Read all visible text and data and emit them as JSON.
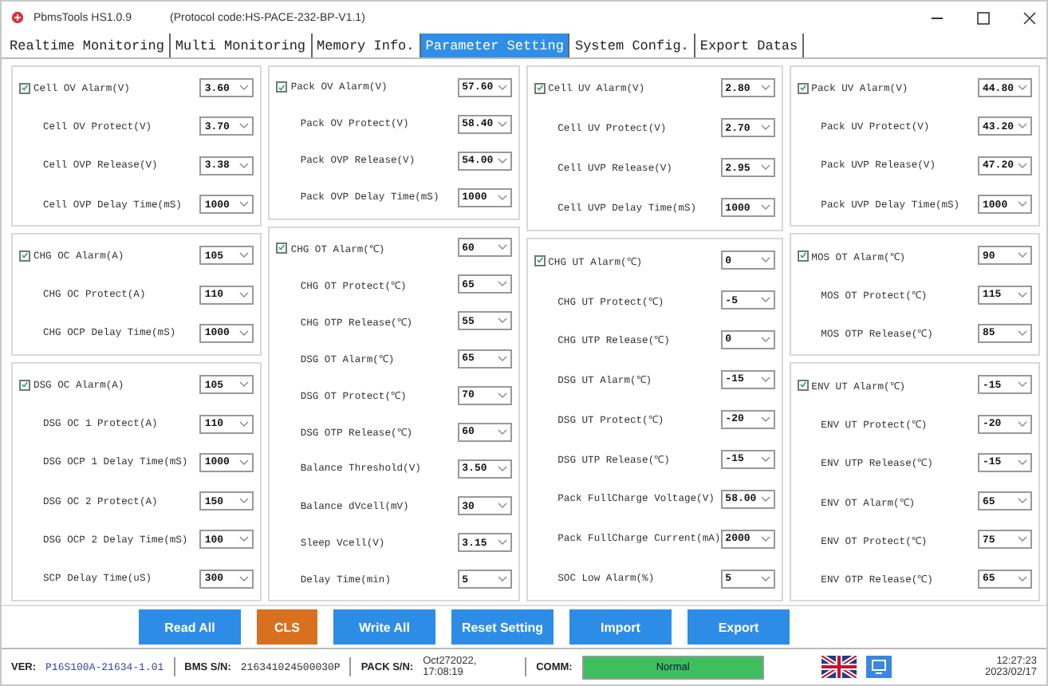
{
  "window": {
    "title": "PbmsTools HS1.0.9",
    "subtitle": "(Protocol code:HS-PACE-232-BP-V1.1)"
  },
  "tabs": [
    {
      "label": "Realtime Monitoring",
      "selected": false
    },
    {
      "label": "Multi Monitoring",
      "selected": false
    },
    {
      "label": "Memory Info.",
      "selected": false
    },
    {
      "label": "Parameter Setting",
      "selected": true
    },
    {
      "label": "System Config.",
      "selected": false
    },
    {
      "label": "Export Datas",
      "selected": false
    }
  ],
  "columns": [
    {
      "panels": [
        {
          "rows": [
            {
              "kind": "check",
              "checked": true,
              "label": "Cell OV Alarm(V)",
              "value": "3.60"
            },
            {
              "kind": "plain",
              "label": "Cell OV Protect(V)",
              "value": "3.70"
            },
            {
              "kind": "plain",
              "label": "Cell OVP Release(V)",
              "value": "3.38"
            },
            {
              "kind": "plain",
              "label": "Cell OVP Delay Time(mS)",
              "value": "1000"
            }
          ]
        },
        {
          "rows": [
            {
              "kind": "check",
              "checked": true,
              "label": "CHG OC Alarm(A)",
              "value": "105"
            },
            {
              "kind": "plain",
              "label": "CHG OC Protect(A)",
              "value": "110"
            },
            {
              "kind": "plain",
              "label": "CHG OCP Delay Time(mS)",
              "value": "1000"
            }
          ]
        },
        {
          "rows": [
            {
              "kind": "check",
              "checked": true,
              "label": "DSG OC Alarm(A)",
              "value": "105"
            },
            {
              "kind": "plain",
              "label": "DSG OC 1 Protect(A)",
              "value": "110"
            },
            {
              "kind": "plain",
              "label": "DSG OCP 1 Delay Time(mS)",
              "value": "1000"
            },
            {
              "kind": "plain",
              "label": "DSG OC 2 Protect(A)",
              "value": "150"
            },
            {
              "kind": "plain",
              "label": "DSG OCP 2 Delay Time(mS)",
              "value": "100"
            },
            {
              "kind": "plain",
              "label": "SCP Delay Time(uS)",
              "value": "300"
            }
          ]
        }
      ]
    },
    {
      "panels": [
        {
          "rows": [
            {
              "kind": "check",
              "checked": true,
              "label": "Pack OV Alarm(V)",
              "value": "57.60"
            },
            {
              "kind": "plain",
              "label": "Pack OV Protect(V)",
              "value": "58.40"
            },
            {
              "kind": "plain",
              "label": "Pack OVP Release(V)",
              "value": "54.00"
            },
            {
              "kind": "plain",
              "label": "Pack OVP Delay Time(mS)",
              "value": "1000"
            }
          ]
        },
        {
          "rows": [
            {
              "kind": "check",
              "checked": true,
              "label": "CHG OT Alarm(℃)",
              "value": "60"
            },
            {
              "kind": "plain",
              "label": "CHG OT Protect(℃)",
              "value": "65"
            },
            {
              "kind": "plain",
              "label": "CHG OTP Release(℃)",
              "value": "55"
            },
            {
              "kind": "plain",
              "label": "DSG OT Alarm(℃)",
              "value": "65"
            },
            {
              "kind": "plain",
              "label": "DSG OT Protect(℃)",
              "value": "70"
            },
            {
              "kind": "plain",
              "label": "DSG OTP Release(℃)",
              "value": "60"
            },
            {
              "kind": "plain",
              "label": "Balance Threshold(V)",
              "value": "3.50"
            },
            {
              "kind": "plain",
              "label": "Balance dVcell(mV)",
              "value": "30"
            },
            {
              "kind": "plain",
              "label": "Sleep Vcell(V)",
              "value": "3.15"
            },
            {
              "kind": "plain",
              "label": "Delay Time(min)",
              "value": "5"
            }
          ]
        }
      ]
    },
    {
      "panels": [
        {
          "rows": [
            {
              "kind": "check",
              "checked": true,
              "label": "Cell UV Alarm(V)",
              "value": "2.80"
            },
            {
              "kind": "plain",
              "label": "Cell UV Protect(V)",
              "value": "2.70"
            },
            {
              "kind": "plain",
              "label": "Cell UVP Release(V)",
              "value": "2.95"
            },
            {
              "kind": "plain",
              "label": "Cell UVP Delay Time(mS)",
              "value": "1000"
            }
          ]
        },
        {
          "rows": [
            {
              "kind": "check",
              "checked": true,
              "label": "CHG UT Alarm(℃)",
              "value": "0"
            },
            {
              "kind": "plain",
              "label": "CHG UT Protect(℃)",
              "value": "-5"
            },
            {
              "kind": "plain",
              "label": "CHG UTP Release(℃)",
              "value": "0"
            },
            {
              "kind": "plain",
              "label": "DSG UT Alarm(℃)",
              "value": "-15"
            },
            {
              "kind": "plain",
              "label": "DSG UT Protect(℃)",
              "value": "-20"
            },
            {
              "kind": "plain",
              "label": "DSG UTP Release(℃)",
              "value": "-15"
            },
            {
              "kind": "plain",
              "label": "Pack FullCharge Voltage(V)",
              "value": "58.00"
            },
            {
              "kind": "plain",
              "label": "Pack FullCharge Current(mA)",
              "value": "2000"
            },
            {
              "kind": "plain",
              "label": "SOC Low Alarm(%)",
              "value": "5"
            }
          ]
        }
      ]
    },
    {
      "panels": [
        {
          "rows": [
            {
              "kind": "check",
              "checked": true,
              "label": "Pack UV Alarm(V)",
              "value": "44.80"
            },
            {
              "kind": "plain",
              "label": "Pack UV Protect(V)",
              "value": "43.20"
            },
            {
              "kind": "plain",
              "label": "Pack UVP Release(V)",
              "value": "47.20"
            },
            {
              "kind": "plain",
              "label": "Pack UVP Delay Time(mS)",
              "value": "1000"
            }
          ]
        },
        {
          "rows": [
            {
              "kind": "check",
              "checked": true,
              "label": "MOS OT Alarm(℃)",
              "value": "90"
            },
            {
              "kind": "plain",
              "label": "MOS OT Protect(℃)",
              "value": "115"
            },
            {
              "kind": "plain",
              "label": "MOS OTP Release(℃)",
              "value": "85"
            }
          ]
        },
        {
          "rows": [
            {
              "kind": "check",
              "checked": true,
              "label": "ENV UT Alarm(℃)",
              "value": "-15"
            },
            {
              "kind": "plain",
              "label": "ENV UT Protect(℃)",
              "value": "-20"
            },
            {
              "kind": "plain",
              "label": "ENV UTP Release(℃)",
              "value": "-15"
            },
            {
              "kind": "plain",
              "label": "ENV OT Alarm(℃)",
              "value": "65"
            },
            {
              "kind": "plain",
              "label": "ENV OT Protect(℃)",
              "value": "75"
            },
            {
              "kind": "plain",
              "label": "ENV OTP Release(℃)",
              "value": "65"
            }
          ]
        }
      ]
    }
  ],
  "buttons": [
    {
      "label": "Read All",
      "color": "#2d8de6"
    },
    {
      "label": "CLS",
      "color": "#d9701f"
    },
    {
      "label": "Write All",
      "color": "#2d8de6"
    },
    {
      "label": "Reset Setting",
      "color": "#2d8de6"
    },
    {
      "label": "Import",
      "color": "#2d8de6"
    },
    {
      "label": "Export",
      "color": "#2d8de6"
    }
  ],
  "status_bar": {
    "ver_label": "VER:",
    "ver": "P16S100A-21634-1.01",
    "bms_label": "BMS S/N:",
    "bms": "216341024500030P",
    "pack_label": "PACK S/N:",
    "pack": "Oct272022, 17:08:19",
    "comm_label": "COMM:",
    "comm": "Normal",
    "time": "12:27:23",
    "date": "2023/02/17"
  }
}
